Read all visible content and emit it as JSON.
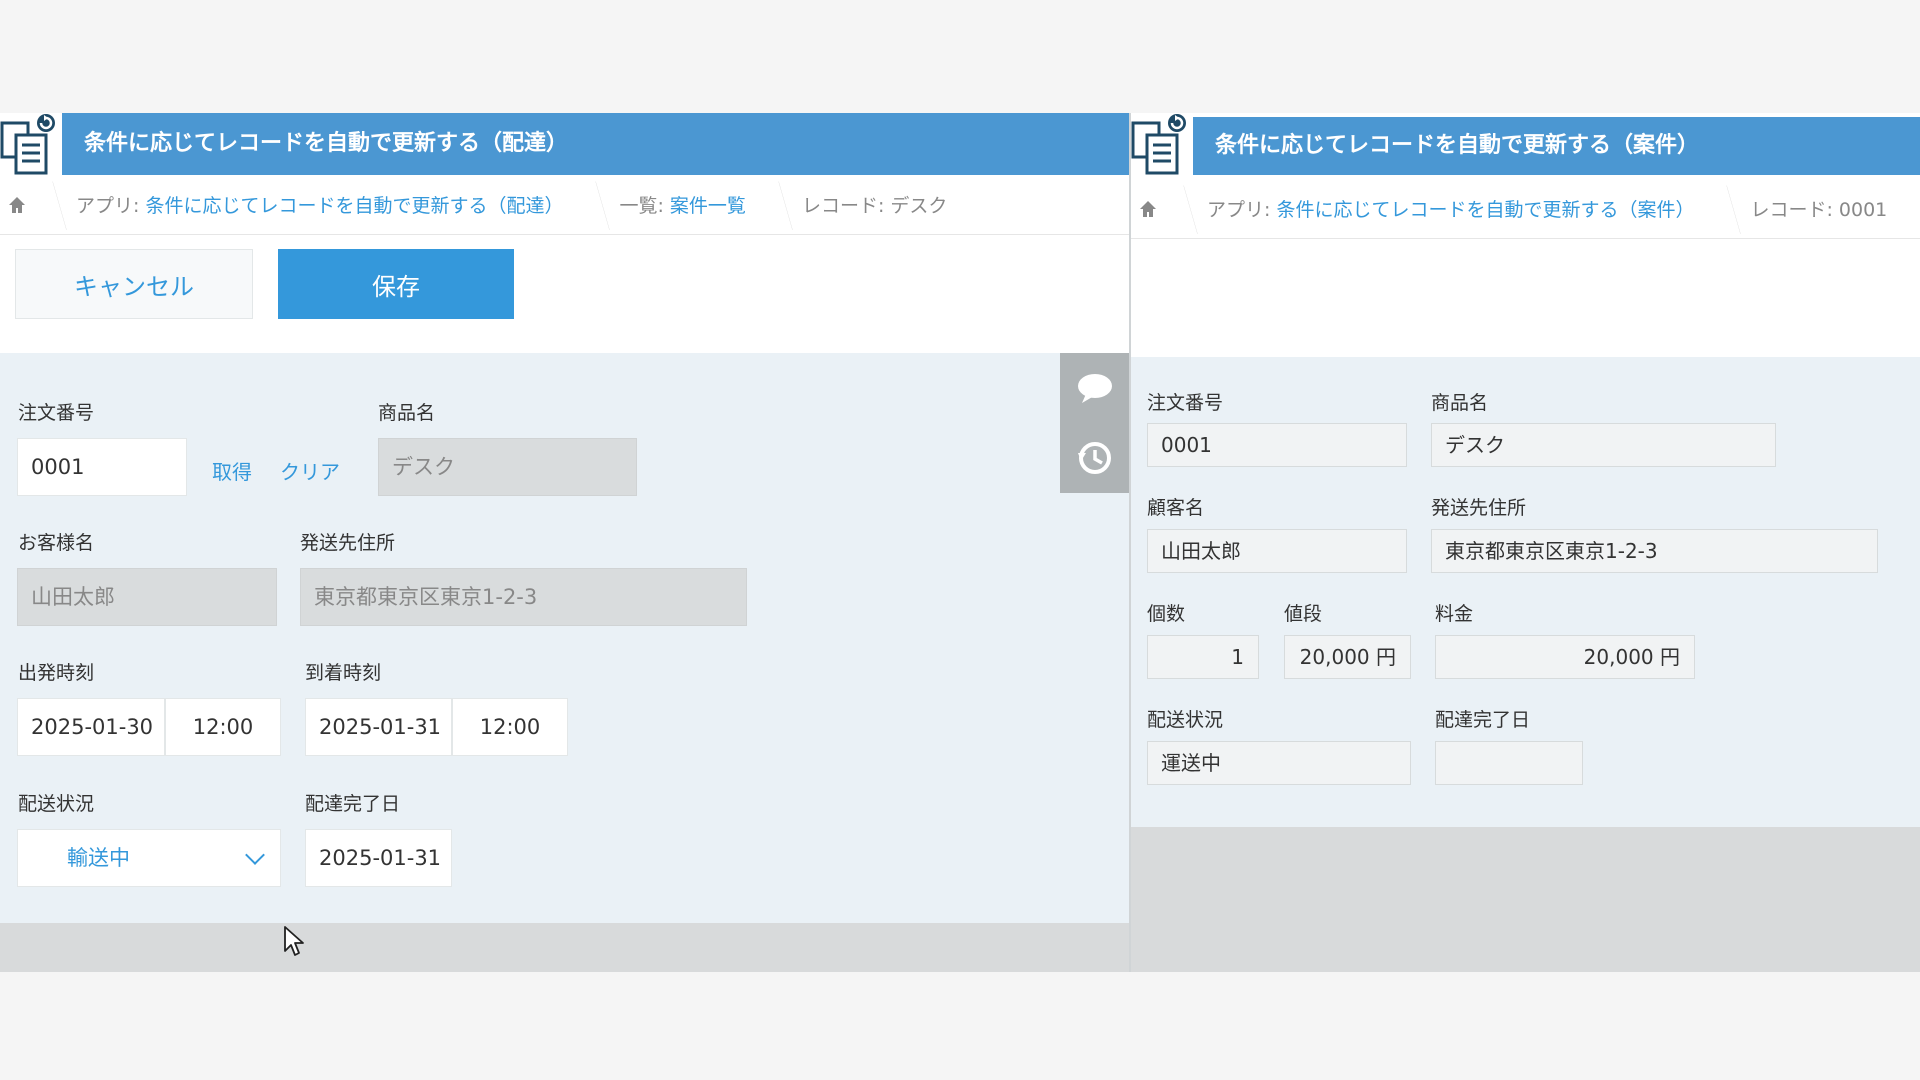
{
  "left": {
    "title": "条件に応じてレコードを自動で更新する（配達）",
    "breadcrumb": {
      "app_prefix": "アプリ: ",
      "app_link": "条件に応じてレコードを自動で更新する（配達）",
      "list_prefix": "一覧: ",
      "list_link": "案件一覧",
      "record": "レコード: デスク"
    },
    "buttons": {
      "cancel": "キャンセル",
      "save": "保存"
    },
    "fields": {
      "order_no": {
        "label": "注文番号",
        "value": "0001"
      },
      "fetch_link": "取得",
      "clear_link": "クリア",
      "product": {
        "label": "商品名",
        "value": "デスク"
      },
      "customer": {
        "label": "お客様名",
        "value": "山田太郎"
      },
      "address": {
        "label": "発送先住所",
        "value": "東京都東京区東京1-2-3"
      },
      "departure": {
        "label": "出発時刻",
        "date": "2025-01-30",
        "time": "12:00"
      },
      "arrival": {
        "label": "到着時刻",
        "date": "2025-01-31",
        "time": "12:00"
      },
      "status": {
        "label": "配送状況",
        "value": "輸送中"
      },
      "delivered_date": {
        "label": "配達完了日",
        "value": "2025-01-31"
      }
    }
  },
  "right": {
    "title": "条件に応じてレコードを自動で更新する（案件）",
    "breadcrumb": {
      "app_prefix": "アプリ: ",
      "app_link": "条件に応じてレコードを自動で更新する（案件）",
      "record": "レコード: 0001"
    },
    "fields": {
      "order_no": {
        "label": "注文番号",
        "value": "0001"
      },
      "product": {
        "label": "商品名",
        "value": "デスク"
      },
      "customer": {
        "label": "顧客名",
        "value": "山田太郎"
      },
      "address": {
        "label": "発送先住所",
        "value": "東京都東京区東京1-2-3"
      },
      "quantity": {
        "label": "個数",
        "value": "1"
      },
      "price": {
        "label": "値段",
        "value": "20,000 円"
      },
      "fee": {
        "label": "料金",
        "value": "20,000 円"
      },
      "status": {
        "label": "配送状況",
        "value": "運送中"
      },
      "delivered_date": {
        "label": "配達完了日",
        "value": ""
      }
    }
  },
  "icons": [
    "app-records-icon",
    "home-icon",
    "comment-icon",
    "history-icon",
    "chevron-down-icon",
    "mouse-cursor-icon"
  ],
  "colors": {
    "header_blue": "#4b97d2",
    "accent_blue": "#3498db",
    "form_bg": "#eaf1f6",
    "disabled_bg": "#d9dcdd"
  }
}
